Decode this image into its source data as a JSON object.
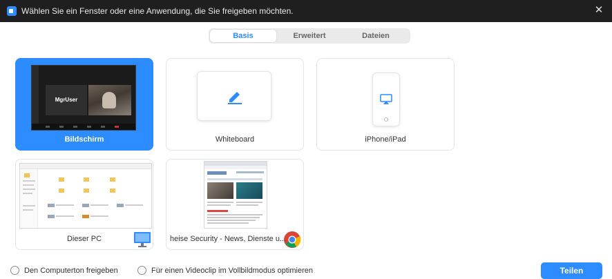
{
  "window": {
    "title": "Wählen Sie ein Fenster oder eine Anwendung, die Sie freigeben möchten.",
    "close_symbol": "✕"
  },
  "tabs": [
    {
      "label": "Basis",
      "active": true
    },
    {
      "label": "Erweitert",
      "active": false
    },
    {
      "label": "Dateien",
      "active": false
    }
  ],
  "cards": {
    "screen": {
      "label": "Bildschirm",
      "thumb_name": "MgrUser",
      "selected": true
    },
    "whiteboard": {
      "label": "Whiteboard",
      "icon": "pencil-icon"
    },
    "iphone": {
      "label": "iPhone/iPad",
      "icon": "airplay-icon"
    },
    "this_pc": {
      "label": "Dieser PC",
      "icon": "monitor-icon"
    },
    "browser": {
      "label": "heise Security - News, Dienste u...",
      "icon": "chrome-icon"
    }
  },
  "footer": {
    "computer_audio": "Den Computerton freigeben",
    "optimize_video": "Für einen Videoclip im Vollbildmodus optimieren",
    "share_button": "Teilen"
  },
  "colors": {
    "accent": "#2d8cff",
    "titlebar": "#1f1f1f"
  }
}
